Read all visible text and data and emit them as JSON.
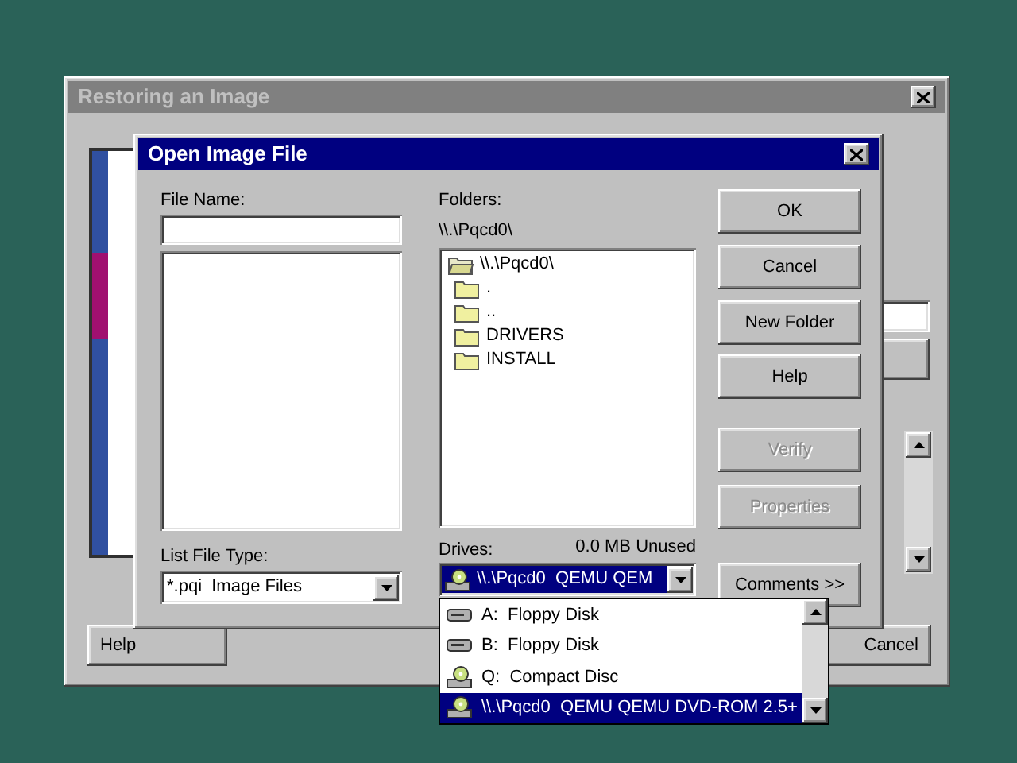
{
  "background_window": {
    "title": "Restoring an Image",
    "buttons": [
      {
        "label": "Help"
      },
      {
        "label": "Cancel"
      }
    ]
  },
  "dialog": {
    "title": "Open Image File",
    "file_name_label": "File Name:",
    "file_type": {
      "label": "List File Type:",
      "value": "*.pqi  Image Files"
    },
    "folders": {
      "label": "Folders:",
      "path": "\\\\.\\Pqcd0\\",
      "tree": [
        {
          "name": "\\\\.\\Pqcd0\\",
          "children": [
            {
              "name": "."
            },
            {
              "name": ".."
            },
            {
              "name": "DRIVERS"
            },
            {
              "name": "INSTALL"
            }
          ]
        }
      ]
    },
    "drives": {
      "label": "Drives:",
      "free": "0.0 MB Unused",
      "value": "\\\\.\\Pqcd0  QEMU QEM",
      "list": [
        {
          "kind": "floppy",
          "label": "A:  Floppy Disk",
          "selected": false
        },
        {
          "kind": "floppy",
          "label": "B:  Floppy Disk",
          "selected": false
        },
        {
          "kind": "cd",
          "label": "Q:  Compact Disc",
          "selected": false
        },
        {
          "kind": "cd",
          "label": "\\\\.\\Pqcd0  QEMU QEMU DVD-ROM 2.5+",
          "selected": true
        }
      ]
    },
    "buttons": [
      {
        "label": "OK",
        "disabled": false
      },
      {
        "label": "Cancel",
        "disabled": false
      },
      {
        "label": "New Folder",
        "disabled": false
      },
      {
        "label": "Help",
        "disabled": false
      },
      {
        "label": "Verify",
        "disabled": true
      },
      {
        "label": "Properties",
        "disabled": true
      },
      {
        "label": "Comments >>",
        "disabled": false
      }
    ]
  }
}
